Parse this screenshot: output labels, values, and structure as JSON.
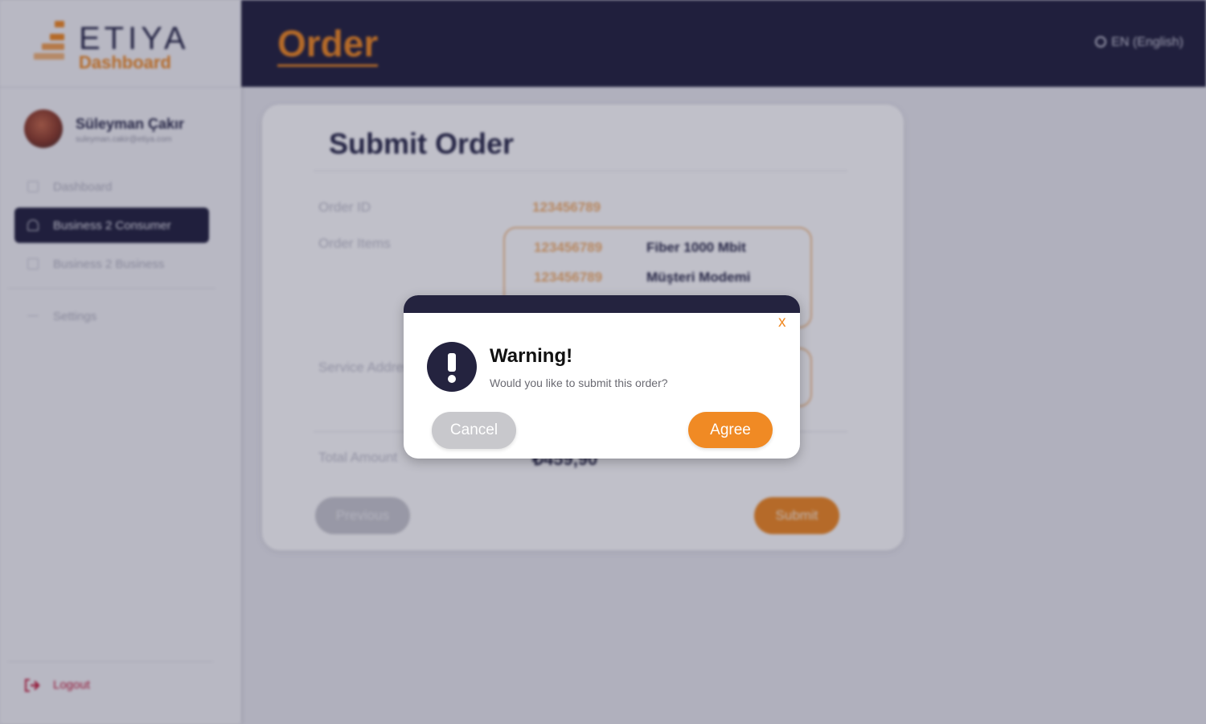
{
  "brand": {
    "name": "ETIYA",
    "subtitle": "Dashboard"
  },
  "user": {
    "name": "Süleyman Çakır",
    "email": "suleyman.cakir@etiya.com"
  },
  "sidebar": {
    "items": [
      {
        "label": "Dashboard",
        "icon": "dashboard-icon",
        "active": false
      },
      {
        "label": "Business 2 Consumer",
        "icon": "user-icon",
        "active": true
      },
      {
        "label": "Business 2 Business",
        "icon": "calendar-icon",
        "active": false
      },
      {
        "label": "Settings",
        "icon": "settings-icon",
        "active": false
      }
    ],
    "logout_label": "Logout"
  },
  "header": {
    "title": "Order",
    "language": "EN (English)"
  },
  "order": {
    "title": "Submit Order",
    "order_id_label": "Order ID",
    "order_id": "123456789",
    "order_items_label": "Order Items",
    "items": [
      {
        "id": "123456789",
        "name": "Fiber 1000 Mbit"
      },
      {
        "id": "123456789",
        "name": "Müşteri Modemi"
      }
    ],
    "service_address_label": "Service Address",
    "total_label": "Total Amount",
    "total_value": "₺459,90",
    "previous_label": "Previous",
    "submit_label": "Submit"
  },
  "dialog": {
    "close_label": "x",
    "title": "Warning!",
    "message": "Would you like to submit this order?",
    "cancel_label": "Cancel",
    "agree_label": "Agree"
  },
  "colors": {
    "accent": "#f08a24",
    "navy": "#24233f",
    "danger": "#c21a3a"
  }
}
